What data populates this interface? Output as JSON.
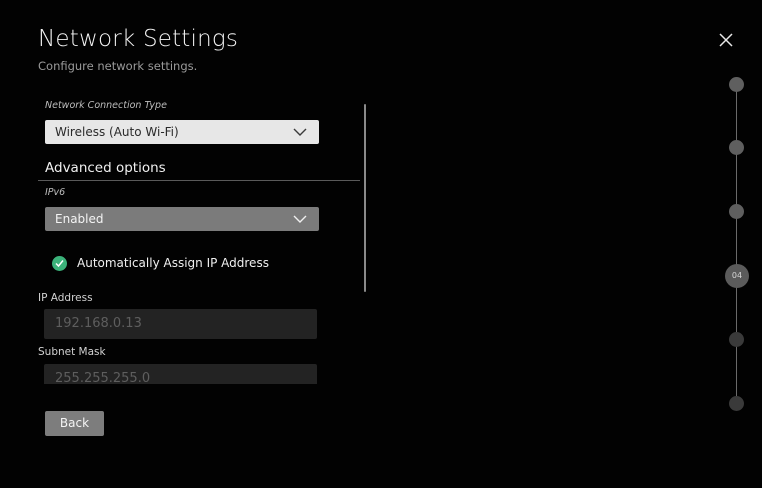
{
  "header": {
    "title": "Network Settings",
    "subtitle": "Configure network settings."
  },
  "connection": {
    "label": "Network Connection Type",
    "value": "Wireless (Auto Wi-Fi)"
  },
  "advanced": {
    "title": "Advanced options",
    "ipv6_label": "IPv6",
    "ipv6_value": "Enabled",
    "auto_ip_label": "Automatically Assign IP Address",
    "auto_ip_checked": true
  },
  "fields": {
    "ip_label": "IP Address",
    "ip_value": "192.168.0.13",
    "subnet_label": "Subnet Mask",
    "subnet_value": "255.255.255.0"
  },
  "footer": {
    "back_label": "Back"
  },
  "stepper": {
    "current_step_label": "04"
  },
  "colors": {
    "background": "#020202",
    "check_accent": "#3bb27a",
    "dropdown_light": "#e7e7e7",
    "dropdown_dark": "#7b7b7b",
    "input_bg": "#232323",
    "button_bg": "#7d7d7d"
  }
}
